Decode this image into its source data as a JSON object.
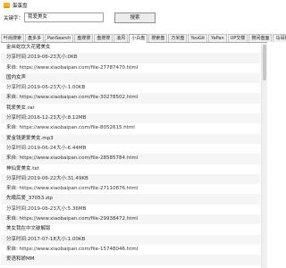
{
  "app": {
    "title": "蛋蛋盘"
  },
  "search": {
    "label": "关键字：",
    "value": "我爱美女",
    "button": "搜索"
  },
  "tabs": [
    "叶尚搜索",
    "盘多多",
    "PanSearch",
    "盘搜搜",
    "盘搜搜",
    "凌风",
    "小白盘",
    "搜索盘",
    "万米盘",
    "YouGit",
    "YaPan",
    "UP交楼",
    "搜间盘面",
    "马哥搜"
  ],
  "active_tab_index": 6,
  "results": [
    "金丝蛇饮大花猪美女",
    "分享时间:2019-06-23大小:0KB",
    "来自: https://www.xiaobaipan.com/file-27787470.html",
    "国内女声",
    "分享时间:2019-06-23大小:1.00KB",
    "来自: https://www.xiaobaipan.com/file-30278502.html",
    "我爱美女.rar",
    "分享时间:2016-12-23大小:8.12MB",
    "来自: https://www.xiaobaipan.com/file-8052615.html",
    "爱金钱更爱美女.mp3",
    "分享时间:2019-06-24大小:6.44MB",
    "来自: https://www.xiaobaipan.com/file-28585784.html",
    "神仙爱美女.txt",
    "分享时间:2019-06-22大小:31.49KB",
    "来自: https://www.xiaobaipan.com/file-27110876.html",
    "先峨后爱_37053.zip",
    "分享时间:2019-06-23大小:5.36MB",
    "来自: https://www.xiaobaipan.com/file-29938472.html",
    "美女我在中文破解版",
    "分享时间:2017-07-18大小:1.00KB",
    "来自: https://www.xiaobaipan.com/file-15748046.html",
    "爱语和娇MM"
  ]
}
